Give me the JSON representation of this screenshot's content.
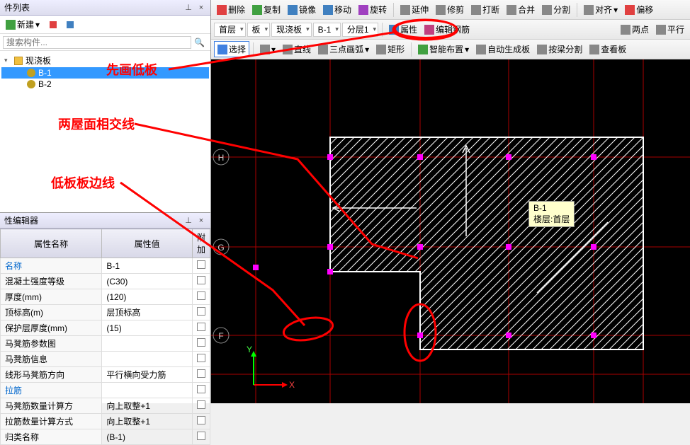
{
  "toolbar1": {
    "delete": "删除",
    "copy": "复制",
    "mirror": "镜像",
    "move": "移动",
    "rotate": "旋转",
    "extend": "延伸",
    "trim": "修剪",
    "break": "打断",
    "merge": "合并",
    "split": "分割",
    "align": "对齐",
    "offset": "偏移"
  },
  "toolbar2": {
    "floor1": "首层",
    "board": "板",
    "cast_board": "现浇板",
    "b1": "B-1",
    "level1": "分层1",
    "properties": "属性",
    "edit_rebar": "编辑钢筋",
    "two_point": "两点",
    "parallel": "平行"
  },
  "toolbar3": {
    "select": "选择",
    "line": "直线",
    "three_point_arc": "三点画弧",
    "rect": "矩形",
    "smart_layout": "智能布置",
    "auto_gen": "自动生成板",
    "beam_split": "按梁分割",
    "view_board": "查看板"
  },
  "left_panel": {
    "title": "件列表",
    "new_label": "新建",
    "search_placeholder": "搜索构件...",
    "tree": {
      "root": "现浇板",
      "items": [
        "B-1",
        "B-2"
      ]
    }
  },
  "prop_panel": {
    "title": "性编辑器",
    "headers": {
      "name": "属性名称",
      "value": "属性值",
      "extra": "附加"
    },
    "rows": [
      {
        "name": "名称",
        "value": "B-1",
        "blue": true
      },
      {
        "name": "混凝土强度等级",
        "value": "(C30)"
      },
      {
        "name": "厚度(mm)",
        "value": "(120)"
      },
      {
        "name": "顶标高(m)",
        "value": "层顶标高"
      },
      {
        "name": "保护层厚度(mm)",
        "value": "(15)"
      },
      {
        "name": "马凳筋参数图",
        "value": ""
      },
      {
        "name": "马凳筋信息",
        "value": ""
      },
      {
        "name": "线形马凳筋方向",
        "value": "平行横向受力筋"
      },
      {
        "name": "拉筋",
        "value": "",
        "blue": true
      },
      {
        "name": "马凳筋数量计算方",
        "value": "向上取整+1"
      },
      {
        "name": "拉筋数量计算方式",
        "value": "向上取整+1"
      },
      {
        "name": "归类名称",
        "value": "(B-1)"
      }
    ]
  },
  "annotations": {
    "line1": "先画低板",
    "line2": "两屋面相交线",
    "line3": "低板板边线"
  },
  "tooltip": {
    "name": "B-1",
    "floor": "楼层:首层"
  },
  "axes": {
    "x": "X",
    "y": "Y"
  },
  "grid_labels": [
    "H",
    "G",
    "F"
  ],
  "chart_data": {
    "type": "diagram",
    "description": "CAD floor plan view with grid lines and hatched board region",
    "grid_rows": [
      "H",
      "G",
      "F"
    ],
    "selected_board": "B-1",
    "floor": "首层"
  }
}
